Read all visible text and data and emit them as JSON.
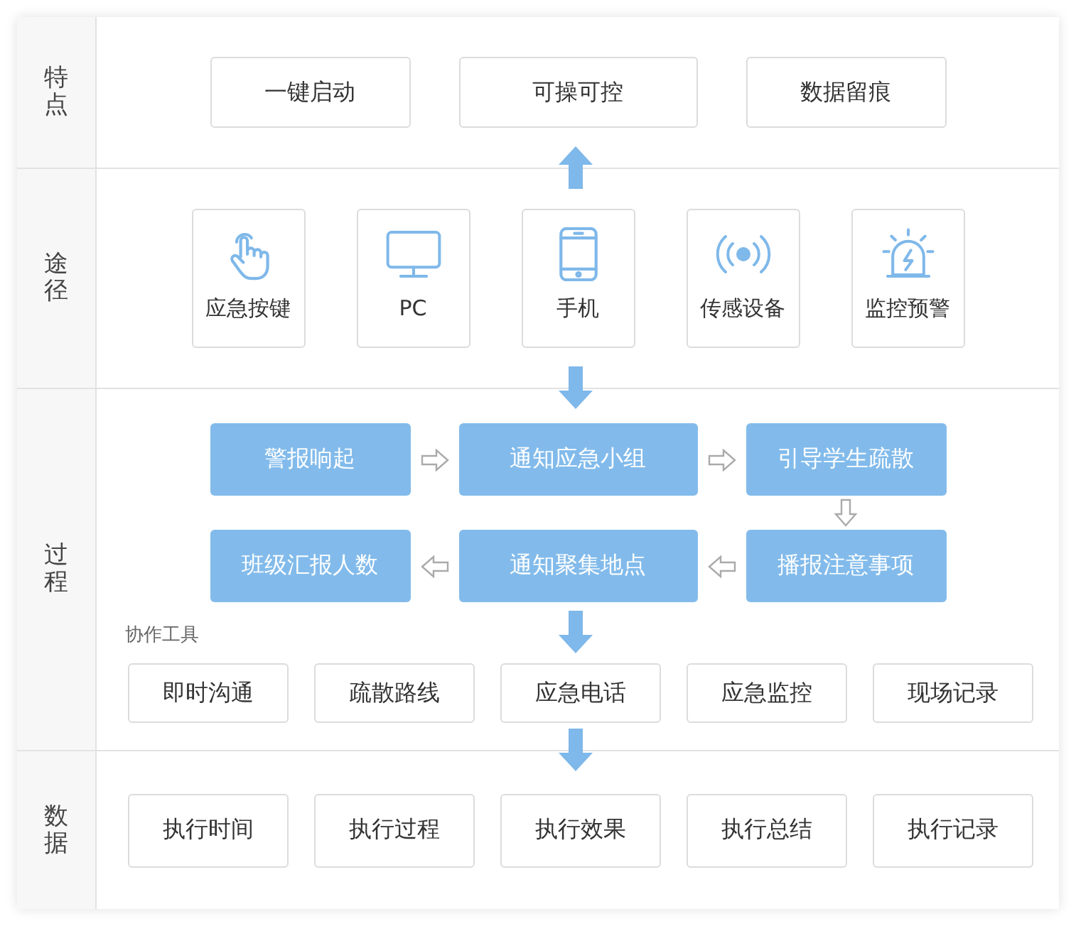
{
  "features": {
    "label": "特点",
    "items": [
      "一键启动",
      "可操可控",
      "数据留痕"
    ]
  },
  "channels": {
    "label": "途径",
    "items": [
      {
        "label": "应急按键",
        "kind": "hand"
      },
      {
        "label": "PC",
        "kind": "monitor"
      },
      {
        "label": "手机",
        "kind": "phone"
      },
      {
        "label": "传感设备",
        "kind": "sensor"
      },
      {
        "label": "监控预警",
        "kind": "alarm"
      }
    ]
  },
  "process": {
    "label": "过程",
    "steps_row_1": [
      "警报响起",
      "通知应急小组",
      "引导学生疏散"
    ],
    "steps_row_2": [
      "班级汇报人数",
      "通知聚集地点",
      "播报注意事项"
    ],
    "tools_title": "协作工具",
    "tools": [
      "即时沟通",
      "疏散路线",
      "应急电话",
      "应急监控",
      "现场记录"
    ]
  },
  "data": {
    "label": "数据",
    "items": [
      "执行时间",
      "执行过程",
      "执行效果",
      "执行总结",
      "执行记录"
    ]
  }
}
